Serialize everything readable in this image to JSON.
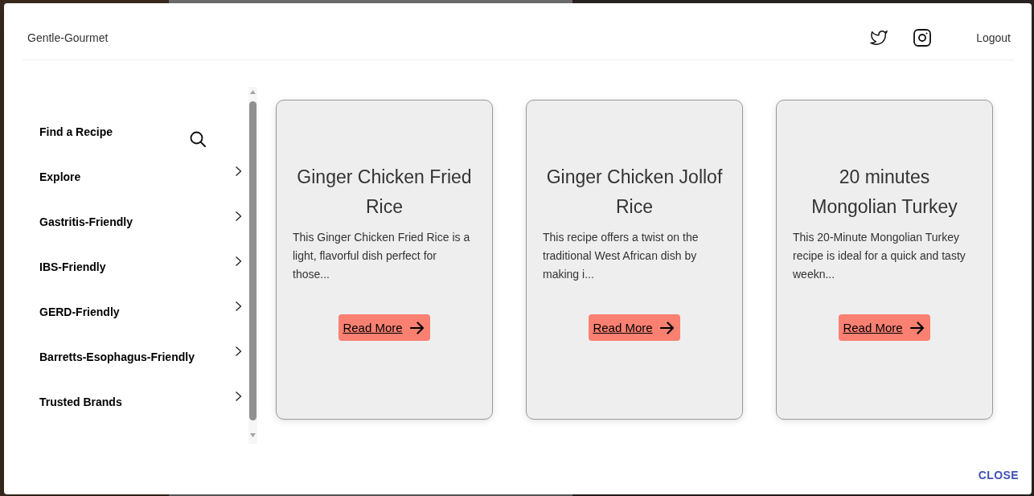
{
  "header": {
    "brand": "Gentle-Gourmet",
    "logout": "Logout"
  },
  "sidebar": {
    "items": [
      {
        "label": "Find a Recipe",
        "kind": "search"
      },
      {
        "label": "Explore",
        "kind": "submenu"
      },
      {
        "label": "Gastritis-Friendly",
        "kind": "submenu"
      },
      {
        "label": "IBS-Friendly",
        "kind": "submenu"
      },
      {
        "label": "GERD-Friendly",
        "kind": "submenu"
      },
      {
        "label": "Barretts-Esophagus-Friendly",
        "kind": "submenu"
      },
      {
        "label": "Trusted Brands",
        "kind": "submenu"
      }
    ]
  },
  "recipes": [
    {
      "title": "Ginger Chicken Fried Rice",
      "description": "This Ginger Chicken Fried Rice is a light, flavorful dish perfect for those...",
      "button": "Read More"
    },
    {
      "title": "Ginger Chicken Jollof Rice",
      "description": "This recipe offers a twist on the traditional West African dish by making i...",
      "button": "Read More"
    },
    {
      "title": "20 minutes Mongolian Turkey",
      "description": "This 20-Minute Mongolian Turkey recipe is ideal for a quick and tasty weekn...",
      "button": "Read More"
    }
  ],
  "dialog": {
    "close_button": "CLOSE"
  }
}
